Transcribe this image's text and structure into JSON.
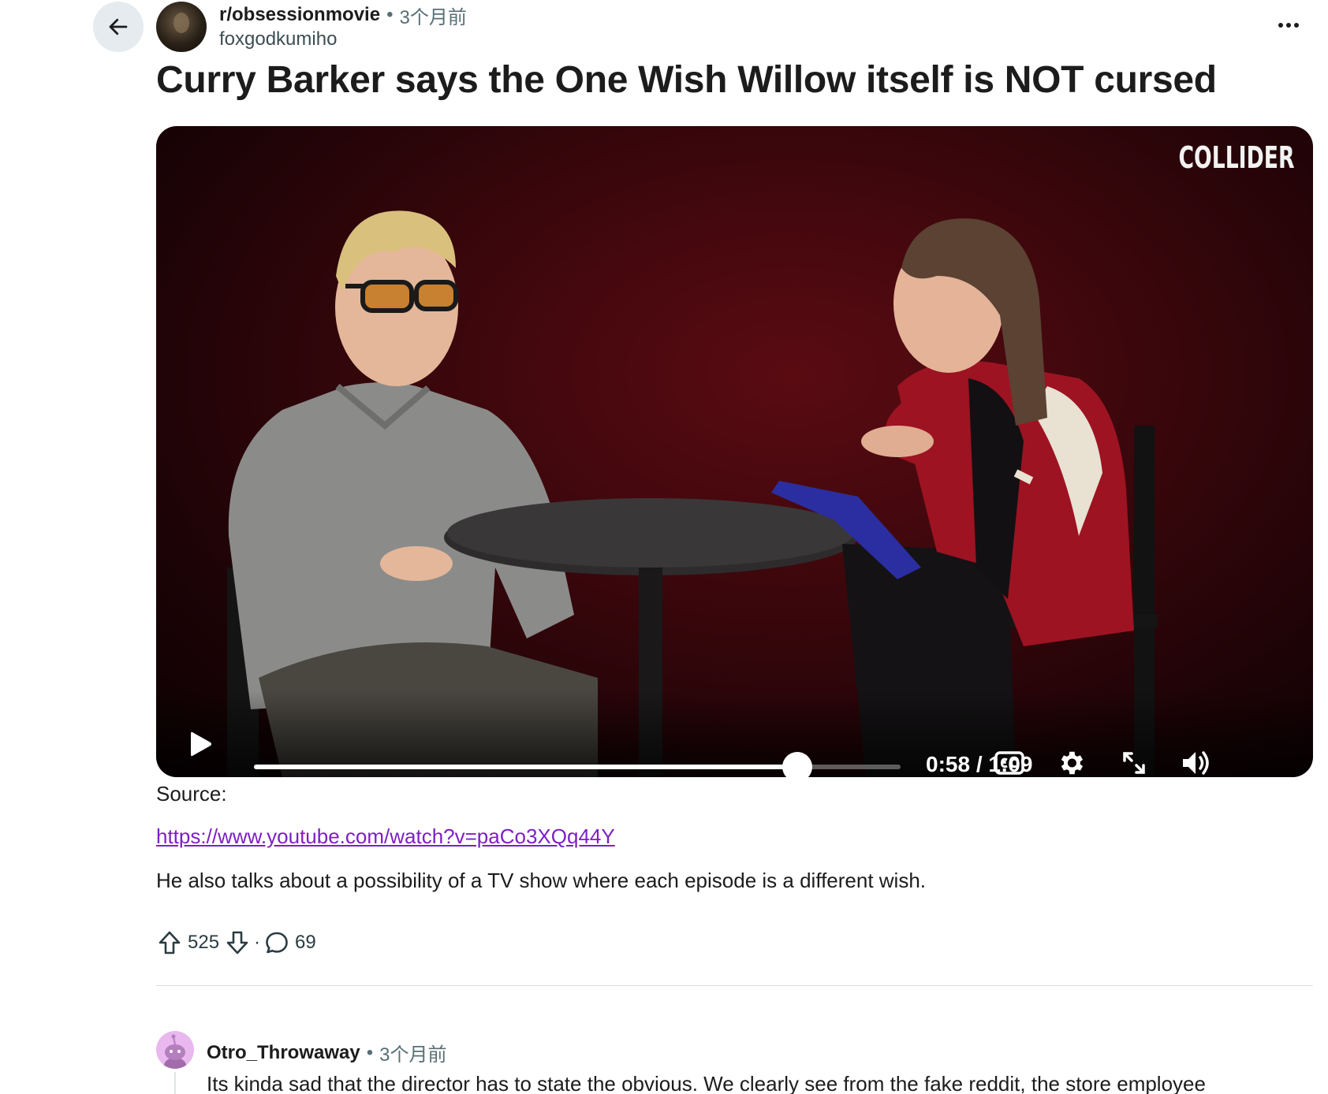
{
  "post": {
    "subreddit": "r/obsessionmovie",
    "separator": "•",
    "time": "3个月前",
    "author": "foxgodkumiho",
    "title": "Curry Barker says the One Wish Willow itself is NOT cursed",
    "source_label": "Source:",
    "source_link": "https://www.youtube.com/watch?v=paCo3XQq44Y",
    "body": "He also talks about a possibility of a TV show where each episode is a different wish."
  },
  "video": {
    "watermark": "COLLIDER",
    "time_readout": "0:58 / 1:09",
    "progress_fraction": 0.8406
  },
  "actions": {
    "upvotes": "525",
    "separator": "·",
    "comments": "69"
  },
  "comment": {
    "author": "Otro_Throwaway",
    "separator": "•",
    "time": "3个月前",
    "text": "Its kinda sad that the director has to state the obvious. We clearly see from the fake reddit, the store employee"
  },
  "icons": {
    "back": "arrow-left-icon",
    "overflow": "more-horizontal-icon",
    "play": "play-icon",
    "captions": "closed-captions-icon",
    "settings": "gear-icon",
    "fullscreen": "fullscreen-icon",
    "volume": "volume-icon",
    "upvote": "upvote-icon",
    "downvote": "downvote-icon",
    "comment": "comment-icon"
  },
  "colors": {
    "link": "#7e1fc4",
    "video_background": "#3c070c",
    "meta_gray": "#576f76"
  }
}
